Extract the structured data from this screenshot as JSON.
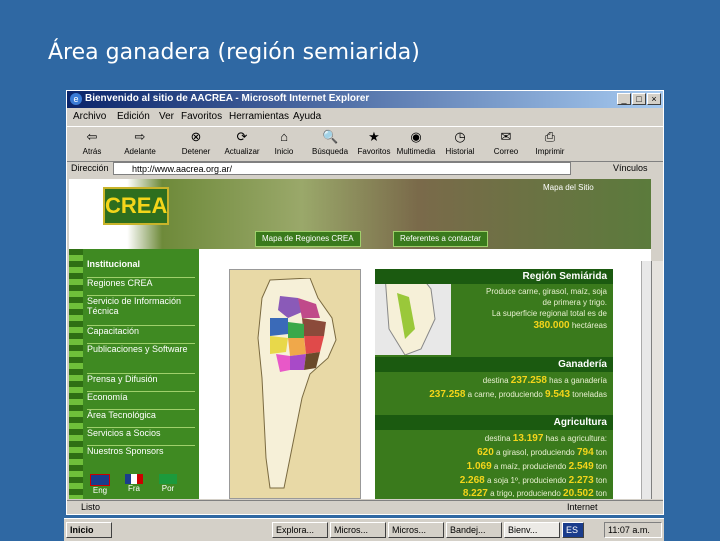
{
  "slide_title": "Área ganadera (región semiarida)",
  "window": {
    "title": "Bienvenido al sitio de AACREA - Microsoft Internet Explorer",
    "min": "_",
    "max": "□",
    "close": "×"
  },
  "menu": [
    "Archivo",
    "Edición",
    "Ver",
    "Favoritos",
    "Herramientas",
    "Ayuda"
  ],
  "toolbar": [
    {
      "label": "Atrás",
      "icon": "back-arrow-icon",
      "glyph": "⇦"
    },
    {
      "label": "Adelante",
      "icon": "forward-arrow-icon",
      "glyph": "⇨"
    },
    {
      "label": "Detener",
      "icon": "stop-icon",
      "glyph": "⊗"
    },
    {
      "label": "Actualizar",
      "icon": "refresh-icon",
      "glyph": "⟳"
    },
    {
      "label": "Inicio",
      "icon": "home-icon",
      "glyph": "⌂"
    },
    {
      "label": "Búsqueda",
      "icon": "search-icon",
      "glyph": "🔍"
    },
    {
      "label": "Favoritos",
      "icon": "favorites-icon",
      "glyph": "★"
    },
    {
      "label": "Multimedia",
      "icon": "media-icon",
      "glyph": "◉"
    },
    {
      "label": "Historial",
      "icon": "history-icon",
      "glyph": "◷"
    },
    {
      "label": "Correo",
      "icon": "mail-icon",
      "glyph": "✉"
    },
    {
      "label": "Imprimir",
      "icon": "print-icon",
      "glyph": "⎙"
    }
  ],
  "address": {
    "label": "Dirección",
    "value": "http://www.aacrea.org.ar/",
    "go": "Vínculos"
  },
  "site": {
    "logo": "CREA",
    "site_map": "Mapa del Sitio",
    "tabs": [
      "Mapa de Regiones CREA",
      "Referentes a contactar"
    ],
    "nav": [
      "Institucional",
      "Regiones CREA",
      "Servicio de Información Técnica",
      "Capacitación",
      "Publicaciones y Software",
      "Prensa y Difusión",
      "Economía",
      "Área Tecnológica",
      "Servicios a Socios",
      "Nuestros Sponsors"
    ],
    "flags": [
      "Eng",
      "Fra",
      "Por"
    ]
  },
  "panel": {
    "region_title": "Región Semiárida",
    "region_lines": [
      "Produce carne, girasol, maíz, soja",
      "de primera y trigo.",
      "La superficie regional total es de"
    ],
    "region_value": "380.000",
    "region_unit": "hectáreas",
    "ganaderia_title": "Ganadería",
    "gan_pre": "destina",
    "gan_value": "237.258",
    "gan_mid": "has a ganadería",
    "gan2_value": "237.258",
    "gan2_mid": "a carne, produciendo",
    "gan2_value2": "9.543",
    "gan2_unit": "toneladas",
    "agricultura_title": "Agricultura",
    "agr_pre": "destina",
    "agr_value": "13.197",
    "agr_mid": "has a agricultura:",
    "rows": [
      {
        "a": "620",
        "mid": "a girasol, produciendo",
        "b": "794",
        "u": "ton"
      },
      {
        "a": "1.069",
        "mid": "a maíz, produciendo",
        "b": "2.549",
        "u": "ton"
      },
      {
        "a": "2.268",
        "mid": "a soja 1º, produciendo",
        "b": "2.273",
        "u": "ton"
      },
      {
        "a": "8.227",
        "mid": "a trigo, produciendo",
        "b": "20.502",
        "u": "ton"
      }
    ]
  },
  "status": {
    "left": "Listo",
    "zone": "Internet"
  },
  "taskbar": {
    "start": "Inicio",
    "tasks": [
      "Explora...",
      "Micros...",
      "Micros...",
      "Bandej...",
      "Bienv..."
    ],
    "lang": "ES",
    "clock": "11:07 a.m."
  }
}
